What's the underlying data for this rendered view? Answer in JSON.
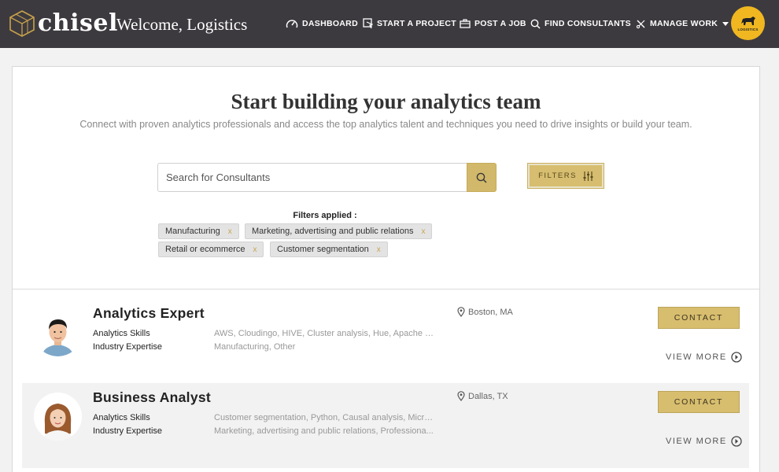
{
  "nav": {
    "brand": "chisel",
    "welcome": "Welcome, Logistics",
    "items": [
      {
        "label": "DASHBOARD",
        "icon": "gauge-icon"
      },
      {
        "label": "START A PROJECT",
        "icon": "cursor-icon"
      },
      {
        "label": "POST A JOB",
        "icon": "briefcase-icon"
      },
      {
        "label": "FIND CONSULTANTS",
        "icon": "search-icon"
      },
      {
        "label": "MANAGE WORK",
        "icon": "tools-icon"
      }
    ],
    "account_logo_text": "LOGISTICS",
    "accent_color": "#f0b721",
    "bar_color": "#3d3a3f"
  },
  "hero": {
    "title": "Start building your analytics team",
    "subtitle": "Connect with proven analytics professionals and access the top analytics talent and techniques you need to drive insights or build your team.",
    "search_placeholder": "Search for Consultants",
    "filters_button": "FILTERS",
    "filters_applied_label": "Filters applied :",
    "chips": [
      "Manufacturing",
      "Marketing, advertising and public relations",
      "Retail or ecommerce",
      "Customer segmentation"
    ],
    "chip_remove": "x",
    "button_color": "#d2b86a"
  },
  "results": [
    {
      "title": "Analytics Expert",
      "skills_label": "Analytics Skills",
      "skills": "AWS, Cloudingo, HIVE, Cluster analysis, Hue, Apache H...",
      "industry_label": "Industry Expertise",
      "industry": "Manufacturing, Other",
      "location": "Boston, MA",
      "contact": "CONTACT",
      "view_more": "VIEW MORE"
    },
    {
      "title": "Business Analyst",
      "skills_label": "Analytics Skills",
      "skills": "Customer segmentation, Python, Causal analysis, Micro...",
      "industry_label": "Industry Expertise",
      "industry": "Marketing, advertising and public relations, Professiona...",
      "location": "Dallas, TX",
      "contact": "CONTACT",
      "view_more": "VIEW MORE"
    }
  ]
}
